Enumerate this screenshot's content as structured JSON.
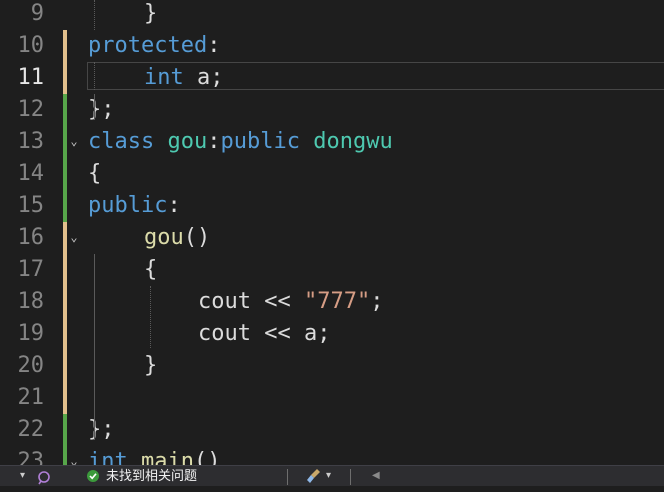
{
  "editor": {
    "active_line": "11",
    "lines": [
      {
        "num": "9",
        "tokens": [
          {
            "t": "}",
            "c": "pl"
          }
        ]
      },
      {
        "num": "10",
        "tokens": [
          {
            "t": "protected",
            "c": "kw"
          },
          {
            "t": ":",
            "c": "pl"
          }
        ]
      },
      {
        "num": "11",
        "tokens": [
          {
            "t": "int",
            "c": "kw"
          },
          {
            "t": " a;",
            "c": "pl"
          }
        ]
      },
      {
        "num": "12",
        "tokens": [
          {
            "t": "};",
            "c": "pl"
          }
        ]
      },
      {
        "num": "13",
        "tokens": [
          {
            "t": "class",
            "c": "kw"
          },
          {
            "t": " ",
            "c": "pl"
          },
          {
            "t": "gou",
            "c": "ty"
          },
          {
            "t": ":",
            "c": "pl"
          },
          {
            "t": "public",
            "c": "kw"
          },
          {
            "t": " ",
            "c": "pl"
          },
          {
            "t": "dongwu",
            "c": "ty"
          }
        ]
      },
      {
        "num": "14",
        "tokens": [
          {
            "t": "{",
            "c": "pl"
          }
        ]
      },
      {
        "num": "15",
        "tokens": [
          {
            "t": "public",
            "c": "kw"
          },
          {
            "t": ":",
            "c": "pl"
          }
        ]
      },
      {
        "num": "16",
        "tokens": [
          {
            "t": "gou",
            "c": "fn"
          },
          {
            "t": "()",
            "c": "pl"
          }
        ]
      },
      {
        "num": "17",
        "tokens": [
          {
            "t": "{",
            "c": "pl"
          }
        ]
      },
      {
        "num": "18",
        "tokens": [
          {
            "t": "cout",
            "c": "pl"
          },
          {
            "t": " << ",
            "c": "pl"
          },
          {
            "t": "\"777\"",
            "c": "str"
          },
          {
            "t": ";",
            "c": "pl"
          }
        ]
      },
      {
        "num": "19",
        "tokens": [
          {
            "t": "cout",
            "c": "pl"
          },
          {
            "t": " << a;",
            "c": "pl"
          }
        ]
      },
      {
        "num": "20",
        "tokens": [
          {
            "t": "}",
            "c": "pl"
          }
        ]
      },
      {
        "num": "21",
        "tokens": []
      },
      {
        "num": "22",
        "tokens": [
          {
            "t": "};",
            "c": "pl"
          }
        ]
      },
      {
        "num": "23",
        "tokens": [
          {
            "t": "int",
            "c": "kw"
          },
          {
            "t": " ",
            "c": "pl"
          },
          {
            "t": "main",
            "c": "fn"
          },
          {
            "t": "()",
            "c": "pl"
          }
        ]
      }
    ]
  },
  "status_bar": {
    "issues_text": "未找到相关问题",
    "check_icon": "check-circle-icon",
    "copilot_icon": "intellisense-icon",
    "brush_icon": "code-cleanup-brush-icon"
  },
  "colors": {
    "keyword": "#569cd6",
    "type": "#4ec9b0",
    "function": "#dcdcaa",
    "string": "#d69d85",
    "saved_change": "#57a64a",
    "unsaved_change": "#e2c08d"
  }
}
